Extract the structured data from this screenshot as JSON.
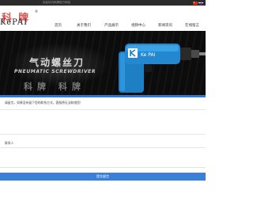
{
  "topbar": {
    "text": "欢迎访问科牌官方网站",
    "flags": [
      "china-flag-icon",
      "uk-flag-icon"
    ]
  },
  "logo": {
    "cn": "科牌",
    "en": "KePAI",
    "reg_mark": "®"
  },
  "nav": {
    "items": [
      {
        "label": "首页"
      },
      {
        "label": "关于我们"
      },
      {
        "label": "产品展示"
      },
      {
        "label": "视频中心"
      },
      {
        "label": "新闻资讯"
      },
      {
        "label": "在线留言"
      }
    ]
  },
  "hero": {
    "title": "气动螺丝刀",
    "subtitle": "PNEUMATIC SCREWDRIVER",
    "tool_brand": "Ke PAI",
    "cut_text": "科牌 科牌"
  },
  "form": {
    "message": "请留言，如果没有留下您的联系方式，客服将无法联络您！",
    "label": "联系人",
    "submit_label": "提交留言"
  },
  "colors": {
    "accent_blue": "#3b7fd8",
    "brand_red": "#d9534f",
    "topbar_bg": "#2b2b2b",
    "hero_bg": "#0c0c0c"
  }
}
